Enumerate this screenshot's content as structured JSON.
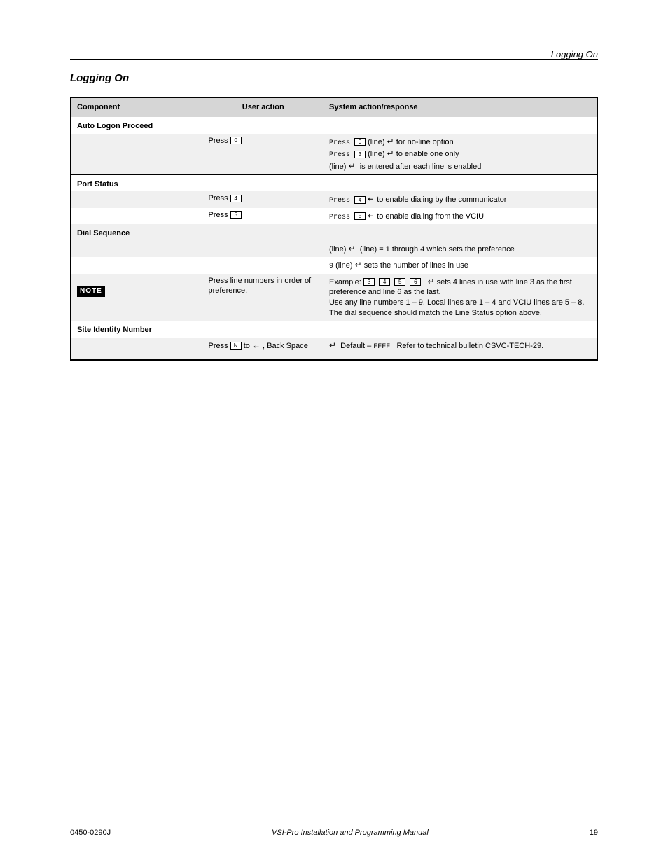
{
  "header": {
    "right_title": "Logging On"
  },
  "section": {
    "heading": "Logging On"
  },
  "table": {
    "cols": {
      "comp": "Component",
      "user": "User action",
      "sys": "System action/response"
    },
    "groupA": {
      "title": "Auto Logon Proceed",
      "r1": {
        "comp": "",
        "user_pre": "Press ",
        "user_key": "0",
        "sys": "Press 0 (line) [ENTER] for no-line option\nPress 3 (line) [ENTER] to enable one only\n(line) [ENTER]   is entered after each line is enabled"
      }
    },
    "groupB": {
      "title": "Port Status",
      "r1": {
        "comp": "",
        "user_pre": "Press ",
        "user_key": "4",
        "sys": "Press 4 [ENTER] to enable dialing by the communicator"
      },
      "r2": {
        "comp": "",
        "user_pre": "Press ",
        "user_key": "5",
        "sys": "Press 5 [ENTER] to enable dialing from the VCIU"
      }
    },
    "groupC": {
      "title": "Dial Sequence",
      "r1": {
        "comp": "",
        "user": "",
        "sys": "(line) [ENTER] (line) = 1 through 4 which sets the preference"
      },
      "r2": {
        "comp": "",
        "user": "",
        "sys": "9 (line) [ENTER] sets the number of lines in use"
      },
      "r3": {
        "comp": "",
        "user": "Press line numbers in order of preference.",
        "sys_pre": "Example: ",
        "sys_post": " sets 4 lines in use with line 3 as the first preference and line 6 as the last.",
        "note": "Use any line numbers 1 – 9. Local lines are 1 – 4 and VCIU lines are 5 – 8. The dial sequence should match the Line Status option above."
      }
    },
    "groupD": {
      "title": "Site Identity Number",
      "r1": {
        "comp": "",
        "user_pre": "Press ",
        "user_key": "N",
        "user_mid": " to ",
        "user_post": ", Back Space",
        "sys": "[ENTER] Default – FFFF   Refer to technical bulletin CSVC-TECH-29."
      }
    }
  },
  "footer": {
    "left": "0450-0290J",
    "mid": "VSI-Pro Installation and Programming Manual",
    "right": "19"
  }
}
